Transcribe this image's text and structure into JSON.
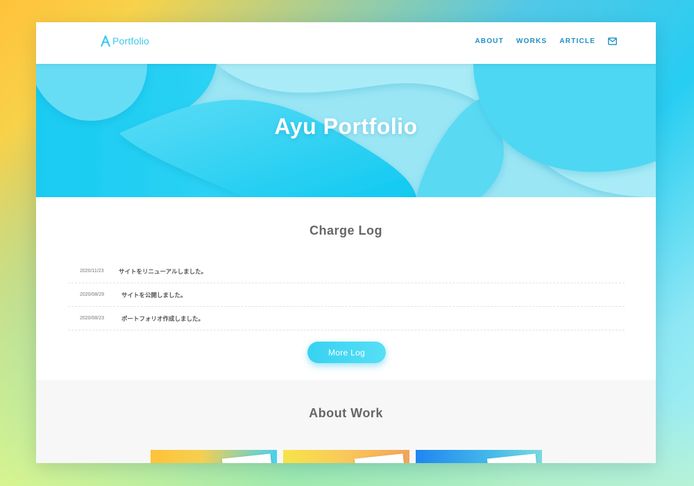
{
  "header": {
    "logo_text": "Portfolio",
    "nav": [
      "ABOUT",
      "WORKS",
      "ARTICLE"
    ]
  },
  "hero": {
    "title": "Ayu Portfolio"
  },
  "changelog": {
    "title": "Charge Log",
    "entries": [
      {
        "date": "2020/11/23",
        "text": "サイトをリニューアルしました。"
      },
      {
        "date": "2020/08/29",
        "text": "サイトを公開しました。"
      },
      {
        "date": "2020/08/23",
        "text": "ポートフォリオ作成しました。"
      }
    ],
    "more_button": "More Log"
  },
  "about": {
    "title": "About Work"
  },
  "colors": {
    "accent": "#3cc9ec",
    "nav": "#1e8fc2",
    "button": "#37d2f2"
  }
}
